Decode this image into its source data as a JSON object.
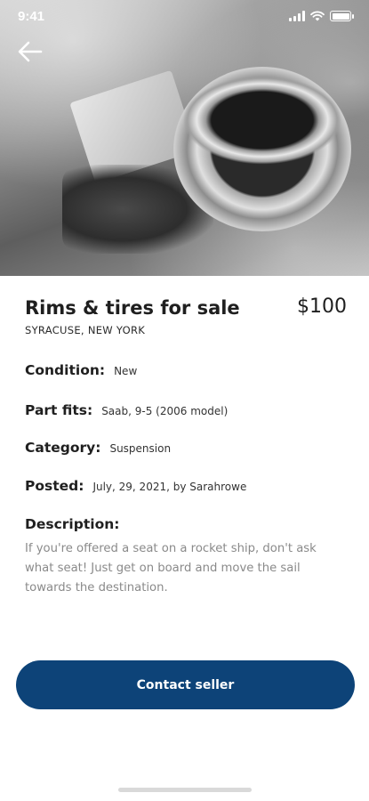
{
  "status_bar": {
    "time": "9:41",
    "icons": [
      "signal-icon",
      "wifi-icon",
      "battery-icon"
    ]
  },
  "header": {
    "back_icon": "arrow-left-icon"
  },
  "listing": {
    "title": "Rims & tires for sale",
    "price": "$100",
    "location": "SYRACUSE, NEW YORK",
    "fields": [
      {
        "label": "Condition:",
        "value": "New"
      },
      {
        "label": "Part fits:",
        "value": "Saab, 9-5 (2006 model)"
      },
      {
        "label": "Category:",
        "value": "Suspension"
      },
      {
        "label": "Posted:",
        "value": "July, 29, 2021, by Sarahrowe"
      }
    ],
    "description_label": "Description:",
    "description": "If you're offered a seat on a rocket ship, don't ask what seat! Just get on board and move the sail towards the destination."
  },
  "actions": {
    "contact_label": "Contact seller"
  },
  "colors": {
    "primary": "#0d4378",
    "text": "#1f1f1f",
    "muted_text": "#8a8a8a"
  }
}
